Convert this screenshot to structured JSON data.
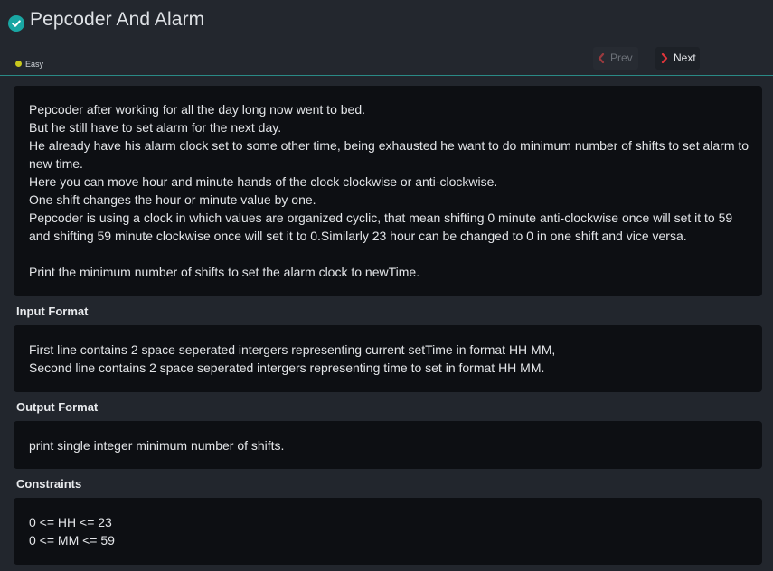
{
  "problem": {
    "title": "Pepcoder And Alarm",
    "difficulty": "Easy",
    "difficulty_color": "#c8c81e",
    "solved_icon": "check-circle-icon"
  },
  "nav": {
    "prev_label": "Prev",
    "next_label": "Next",
    "chevron_color": "#e0353a"
  },
  "description": {
    "lines": [
      "Pepcoder after working for all the day long now went to bed.",
      "But he still have to set alarm for the next day.",
      "He already have his alarm clock set to some other time, being exhausted he want to do minimum number of shifts to set alarm to new time.",
      "Here you can move hour and minute hands of the clock clockwise or anti-clockwise.",
      "One shift changes the hour or minute value by one.",
      "Pepcoder is using a clock in which values are organized cyclic, that mean shifting 0 minute anti-clockwise once will set it to 59 and shifting 59 minute clockwise once will set it to 0.Similarly 23 hour can be changed to 0 in one shift and vice versa.",
      "Print the minimum number of shifts to set the alarm clock to newTime."
    ]
  },
  "input_format": {
    "heading": "Input Format",
    "lines": [
      "First line contains 2 space seperated intergers representing current setTime in format HH MM,",
      "Second line contains 2 space seperated intergers representing time to set in format HH MM."
    ]
  },
  "output_format": {
    "heading": "Output Format",
    "lines": [
      "print single integer minimum number of shifts."
    ]
  },
  "constraints": {
    "heading": "Constraints",
    "lines": [
      "0 <= HH <= 23",
      "0 <= MM <= 59"
    ]
  }
}
